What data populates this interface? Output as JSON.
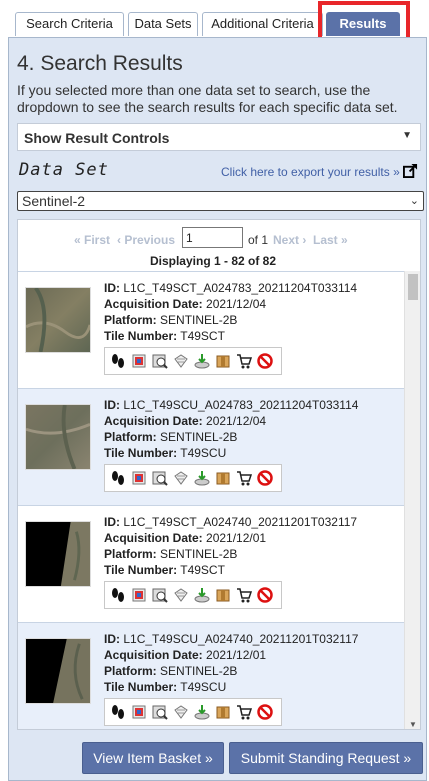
{
  "tabs": [
    {
      "label": "Search Criteria"
    },
    {
      "label": "Data Sets"
    },
    {
      "label": "Additional Criteria"
    },
    {
      "label": "Results"
    }
  ],
  "page": {
    "heading": "4. Search Results",
    "intro": "If you selected more than one data set to search, use the dropdown to see the search results for each specific data set.",
    "controls_label": "Show Result Controls",
    "dataset_label": "Data Set",
    "export_link": "Click here to export your results »",
    "dataset_selected": "Sentinel-2"
  },
  "pager": {
    "first": "« First",
    "previous": "‹ Previous",
    "page_value": "1",
    "of_total": "of 1",
    "next": "Next ›",
    "last": "Last »",
    "displaying": "Displaying 1 - 82 of 82"
  },
  "labels": {
    "id": "ID:",
    "acq": "Acquisition Date:",
    "platform": "Platform:",
    "tile": "Tile Number:"
  },
  "results": [
    {
      "id": "L1C_T49SCT_A024783_20211204T033114",
      "date": "2021/12/04",
      "platform": "SENTINEL-2B",
      "tile": "T49SCT"
    },
    {
      "id": "L1C_T49SCU_A024783_20211204T033114",
      "date": "2021/12/04",
      "platform": "SENTINEL-2B",
      "tile": "T49SCU"
    },
    {
      "id": "L1C_T49SCT_A024740_20211201T032117",
      "date": "2021/12/01",
      "platform": "SENTINEL-2B",
      "tile": "T49SCT"
    },
    {
      "id": "L1C_T49SCU_A024740_20211201T032117",
      "date": "2021/12/01",
      "platform": "SENTINEL-2B",
      "tile": "T49SCU"
    }
  ],
  "buttons": {
    "basket": "View Item Basket »",
    "standing": "Submit Standing Request »"
  },
  "colors": {
    "accent": "#5b72a8",
    "panel_bg": "#dde6f3",
    "highlight": "#e8262a",
    "link": "#4160a6"
  }
}
